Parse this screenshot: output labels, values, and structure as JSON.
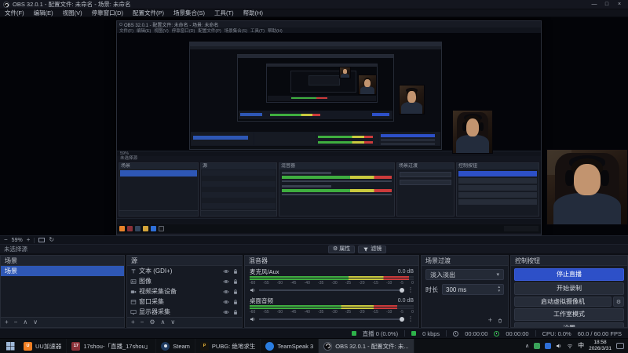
{
  "colors": {
    "accent_blue": "#2e57b5",
    "button_blue": "#2d50c8",
    "meter_green": "#3fae3f",
    "meter_yellow": "#c9c93e",
    "meter_red": "#cc3b3b",
    "status_green": "#2eb24a"
  },
  "icons": {
    "minimize": "—",
    "maximize": "□",
    "close": "×",
    "plus": "+",
    "minus": "−",
    "gear": "⚙",
    "up": "∧",
    "down": "∨",
    "caret": "▾",
    "dots": "⋮",
    "spin_up": "▴",
    "spin_down": "▾",
    "reset": "↻",
    "tray_chevron": "∧"
  },
  "window": {
    "title": "OBS 32.0.1 - 配置文件: 未命名 - 场景: 未命名",
    "menu": [
      "文件(F)",
      "编辑(E)",
      "视图(V)",
      "停靠窗口(D)",
      "配置文件(P)",
      "场景集合(S)",
      "工具(T)",
      "帮助(H)"
    ]
  },
  "preview": {
    "zoom": "59%"
  },
  "source_toolbar": {
    "no_source": "未选择源",
    "properties": "属性",
    "filters": "滤镜"
  },
  "docks": {
    "scenes": {
      "title": "场景",
      "items": [
        {
          "label": "场景"
        }
      ]
    },
    "sources": {
      "title": "源",
      "items": [
        {
          "label": "文本 (GDI+)",
          "icon": "#i-text"
        },
        {
          "label": "图像",
          "icon": "#i-image"
        },
        {
          "label": "视频采集设备",
          "icon": "#i-camera"
        },
        {
          "label": "窗口采集",
          "icon": "#i-window"
        },
        {
          "label": "显示器采集",
          "icon": "#i-display"
        }
      ]
    },
    "mixer": {
      "title": "混音器",
      "scale": [
        "-60",
        "-55",
        "-50",
        "-45",
        "-40",
        "-35",
        "-30",
        "-25",
        "-20",
        "-15",
        "-10",
        "-5",
        "0"
      ],
      "channels": [
        {
          "name": "麦克风/Aux",
          "db": "0.0 dB",
          "meter_fill": "97%"
        },
        {
          "name": "桌面音频",
          "db": "0.0 dB",
          "meter_fill": "90%"
        }
      ]
    },
    "transitions": {
      "title": "场景过渡",
      "current": "淡入淡出",
      "duration_label": "时长",
      "duration": "300 ms"
    },
    "controls": {
      "title": "控制按钮",
      "buttons": [
        {
          "label": "停止直播"
        },
        {
          "label": "开始录制"
        },
        {
          "label": "启动虚拟摄像机"
        },
        {
          "label": "工作室模式"
        },
        {
          "label": "设置"
        }
      ]
    }
  },
  "statusbar": {
    "dropped": "直播 0 (0.0%)",
    "bitrate": "0 kbps",
    "rec_time": "00:00:00",
    "stream_time": "00:00:00",
    "cpu": "CPU: 0.0%",
    "fps": "60.0 / 60.00 FPS"
  },
  "taskbar": {
    "apps": [
      {
        "label": "UU加速器"
      },
      {
        "label": "17shou-「直播_17shou」"
      },
      {
        "label": "Steam"
      },
      {
        "label": "PUBG: 绝地求生"
      },
      {
        "label": "TeamSpeak 3"
      },
      {
        "label": "OBS 32.0.1 - 配置文件: 未..."
      }
    ],
    "tray": {
      "ime": "中",
      "time": "18:58",
      "date": "2026/3/31"
    }
  }
}
